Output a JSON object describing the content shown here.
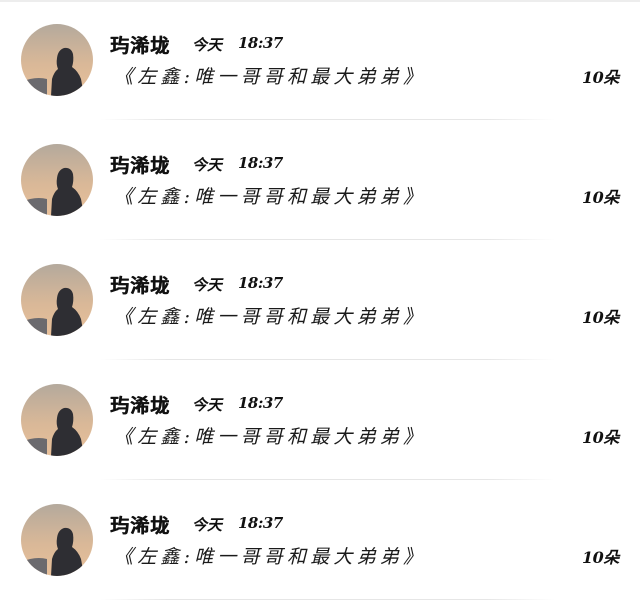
{
  "items": [
    {
      "name": "玙浠垅",
      "day": "今天",
      "time": "18:37",
      "title": "《左鑫:唯一哥哥和最大弟弟》",
      "count": "10朵",
      "avatar_icon": "silhouette-sunset-avatar"
    },
    {
      "name": "玙浠垅",
      "day": "今天",
      "time": "18:37",
      "title": "《左鑫:唯一哥哥和最大弟弟》",
      "count": "10朵",
      "avatar_icon": "silhouette-sunset-avatar"
    },
    {
      "name": "玙浠垅",
      "day": "今天",
      "time": "18:37",
      "title": "《左鑫:唯一哥哥和最大弟弟》",
      "count": "10朵",
      "avatar_icon": "silhouette-sunset-avatar"
    },
    {
      "name": "玙浠垅",
      "day": "今天",
      "time": "18:37",
      "title": "《左鑫:唯一哥哥和最大弟弟》",
      "count": "10朵",
      "avatar_icon": "silhouette-sunset-avatar"
    },
    {
      "name": "玙浠垅",
      "day": "今天",
      "time": "18:37",
      "title": "《左鑫:唯一哥哥和最大弟弟》",
      "count": "10朵",
      "avatar_icon": "silhouette-sunset-avatar"
    }
  ],
  "colors": {
    "sky_top": "#b4a99c",
    "sky_bottom": "#e8c09a",
    "silhouette": "#2e2e33",
    "text": "#111111",
    "divider": "#e6e6e6"
  }
}
